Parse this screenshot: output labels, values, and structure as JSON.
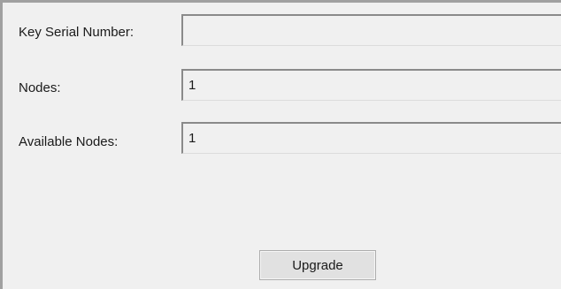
{
  "form": {
    "key_serial_number": {
      "label": "Key Serial Number:",
      "value": ""
    },
    "nodes": {
      "label": "Nodes:",
      "value": "1"
    },
    "available_nodes": {
      "label": "Available Nodes:",
      "value": "1"
    }
  },
  "actions": {
    "upgrade_label": "Upgrade"
  }
}
